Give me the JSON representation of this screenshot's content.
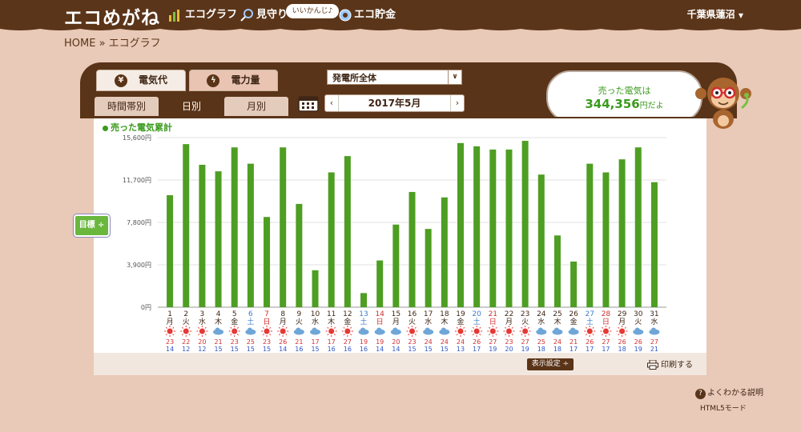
{
  "app": {
    "title": "エコめがね"
  },
  "nav": {
    "items": [
      {
        "label": "エコグラフ"
      },
      {
        "label": "見守り"
      },
      {
        "label": "エコ貯金"
      }
    ],
    "speech": "いいかんじ♪",
    "region": "千葉県蓮沼"
  },
  "breadcrumb": "HOME » エコグラフ",
  "tabs": {
    "main": [
      {
        "label": "電気代",
        "icon": "¥"
      },
      {
        "label": "電力量",
        "icon": "ϟ"
      }
    ],
    "sub": [
      {
        "label": "時間帯別"
      },
      {
        "label": "日別"
      },
      {
        "label": "月別"
      }
    ],
    "active_main": 0,
    "active_sub": 1
  },
  "select": {
    "value": "発電所全体"
  },
  "month_nav": {
    "label": "2017年5月",
    "prev": "‹",
    "next": "›"
  },
  "bubble": {
    "title": "売った電気は",
    "value": "344,356",
    "unit": "円だよ"
  },
  "goal_button": "目標 ÷",
  "display_button": "表示設定 ÷",
  "print_button": "印刷する",
  "help_link": "よくわかる説明",
  "html5_link": "HTML5モード",
  "colors": {
    "bar": "#4d9e22",
    "sunday": "#d32f2f",
    "saturday": "#3a7dc9",
    "weekday": "#3f2616",
    "high": "#d32f2f",
    "low": "#2f57c9"
  },
  "chart_data": {
    "type": "bar",
    "title": "売った電気累計",
    "ylim": [
      0,
      15600
    ],
    "yticks": [
      "0円",
      "3,900円",
      "7,800円",
      "11,700円",
      "15,600円"
    ],
    "categories": [
      "1",
      "2",
      "3",
      "4",
      "5",
      "6",
      "7",
      "8",
      "9",
      "10",
      "11",
      "12",
      "13",
      "14",
      "15",
      "16",
      "17",
      "18",
      "19",
      "20",
      "21",
      "22",
      "23",
      "24",
      "25",
      "26",
      "27",
      "28",
      "29",
      "30",
      "31"
    ],
    "weekdays": [
      "月",
      "火",
      "水",
      "木",
      "金",
      "土",
      "日",
      "月",
      "火",
      "水",
      "木",
      "金",
      "土",
      "日",
      "月",
      "火",
      "水",
      "木",
      "金",
      "土",
      "日",
      "月",
      "火",
      "水",
      "木",
      "金",
      "土",
      "日",
      "月",
      "火",
      "水"
    ],
    "values": [
      10300,
      15000,
      13100,
      12500,
      14700,
      13200,
      8300,
      14700,
      9500,
      3400,
      12400,
      13900,
      1300,
      4300,
      7600,
      10600,
      7200,
      10100,
      15100,
      14800,
      14500,
      14500,
      15300,
      12200,
      6600,
      4200,
      13200,
      12400,
      13600,
      14700,
      11500
    ],
    "weather": [
      "sun",
      "sun",
      "sun",
      "cloud",
      "sun",
      "cloud",
      "sun",
      "sun",
      "cloud",
      "cloud",
      "sun",
      "sun",
      "cloud",
      "cloud",
      "cloud",
      "sun",
      "cloud",
      "cloud",
      "sun",
      "sun",
      "sun",
      "sun",
      "sun",
      "cloud",
      "cloud",
      "cloud",
      "sun",
      "sun",
      "sun",
      "cloud",
      "cloud"
    ],
    "high_temp": [
      23,
      22,
      20,
      21,
      23,
      25,
      23,
      26,
      21,
      17,
      17,
      27,
      19,
      19,
      20,
      23,
      24,
      24,
      24,
      26,
      27,
      23,
      27,
      25,
      24,
      21,
      26,
      27,
      26,
      26,
      27
    ],
    "low_temp": [
      14,
      12,
      12,
      15,
      15,
      15,
      15,
      14,
      16,
      15,
      16,
      16,
      16,
      14,
      14,
      15,
      15,
      15,
      13,
      17,
      19,
      20,
      19,
      18,
      18,
      17,
      17,
      17,
      18,
      19,
      21
    ]
  }
}
